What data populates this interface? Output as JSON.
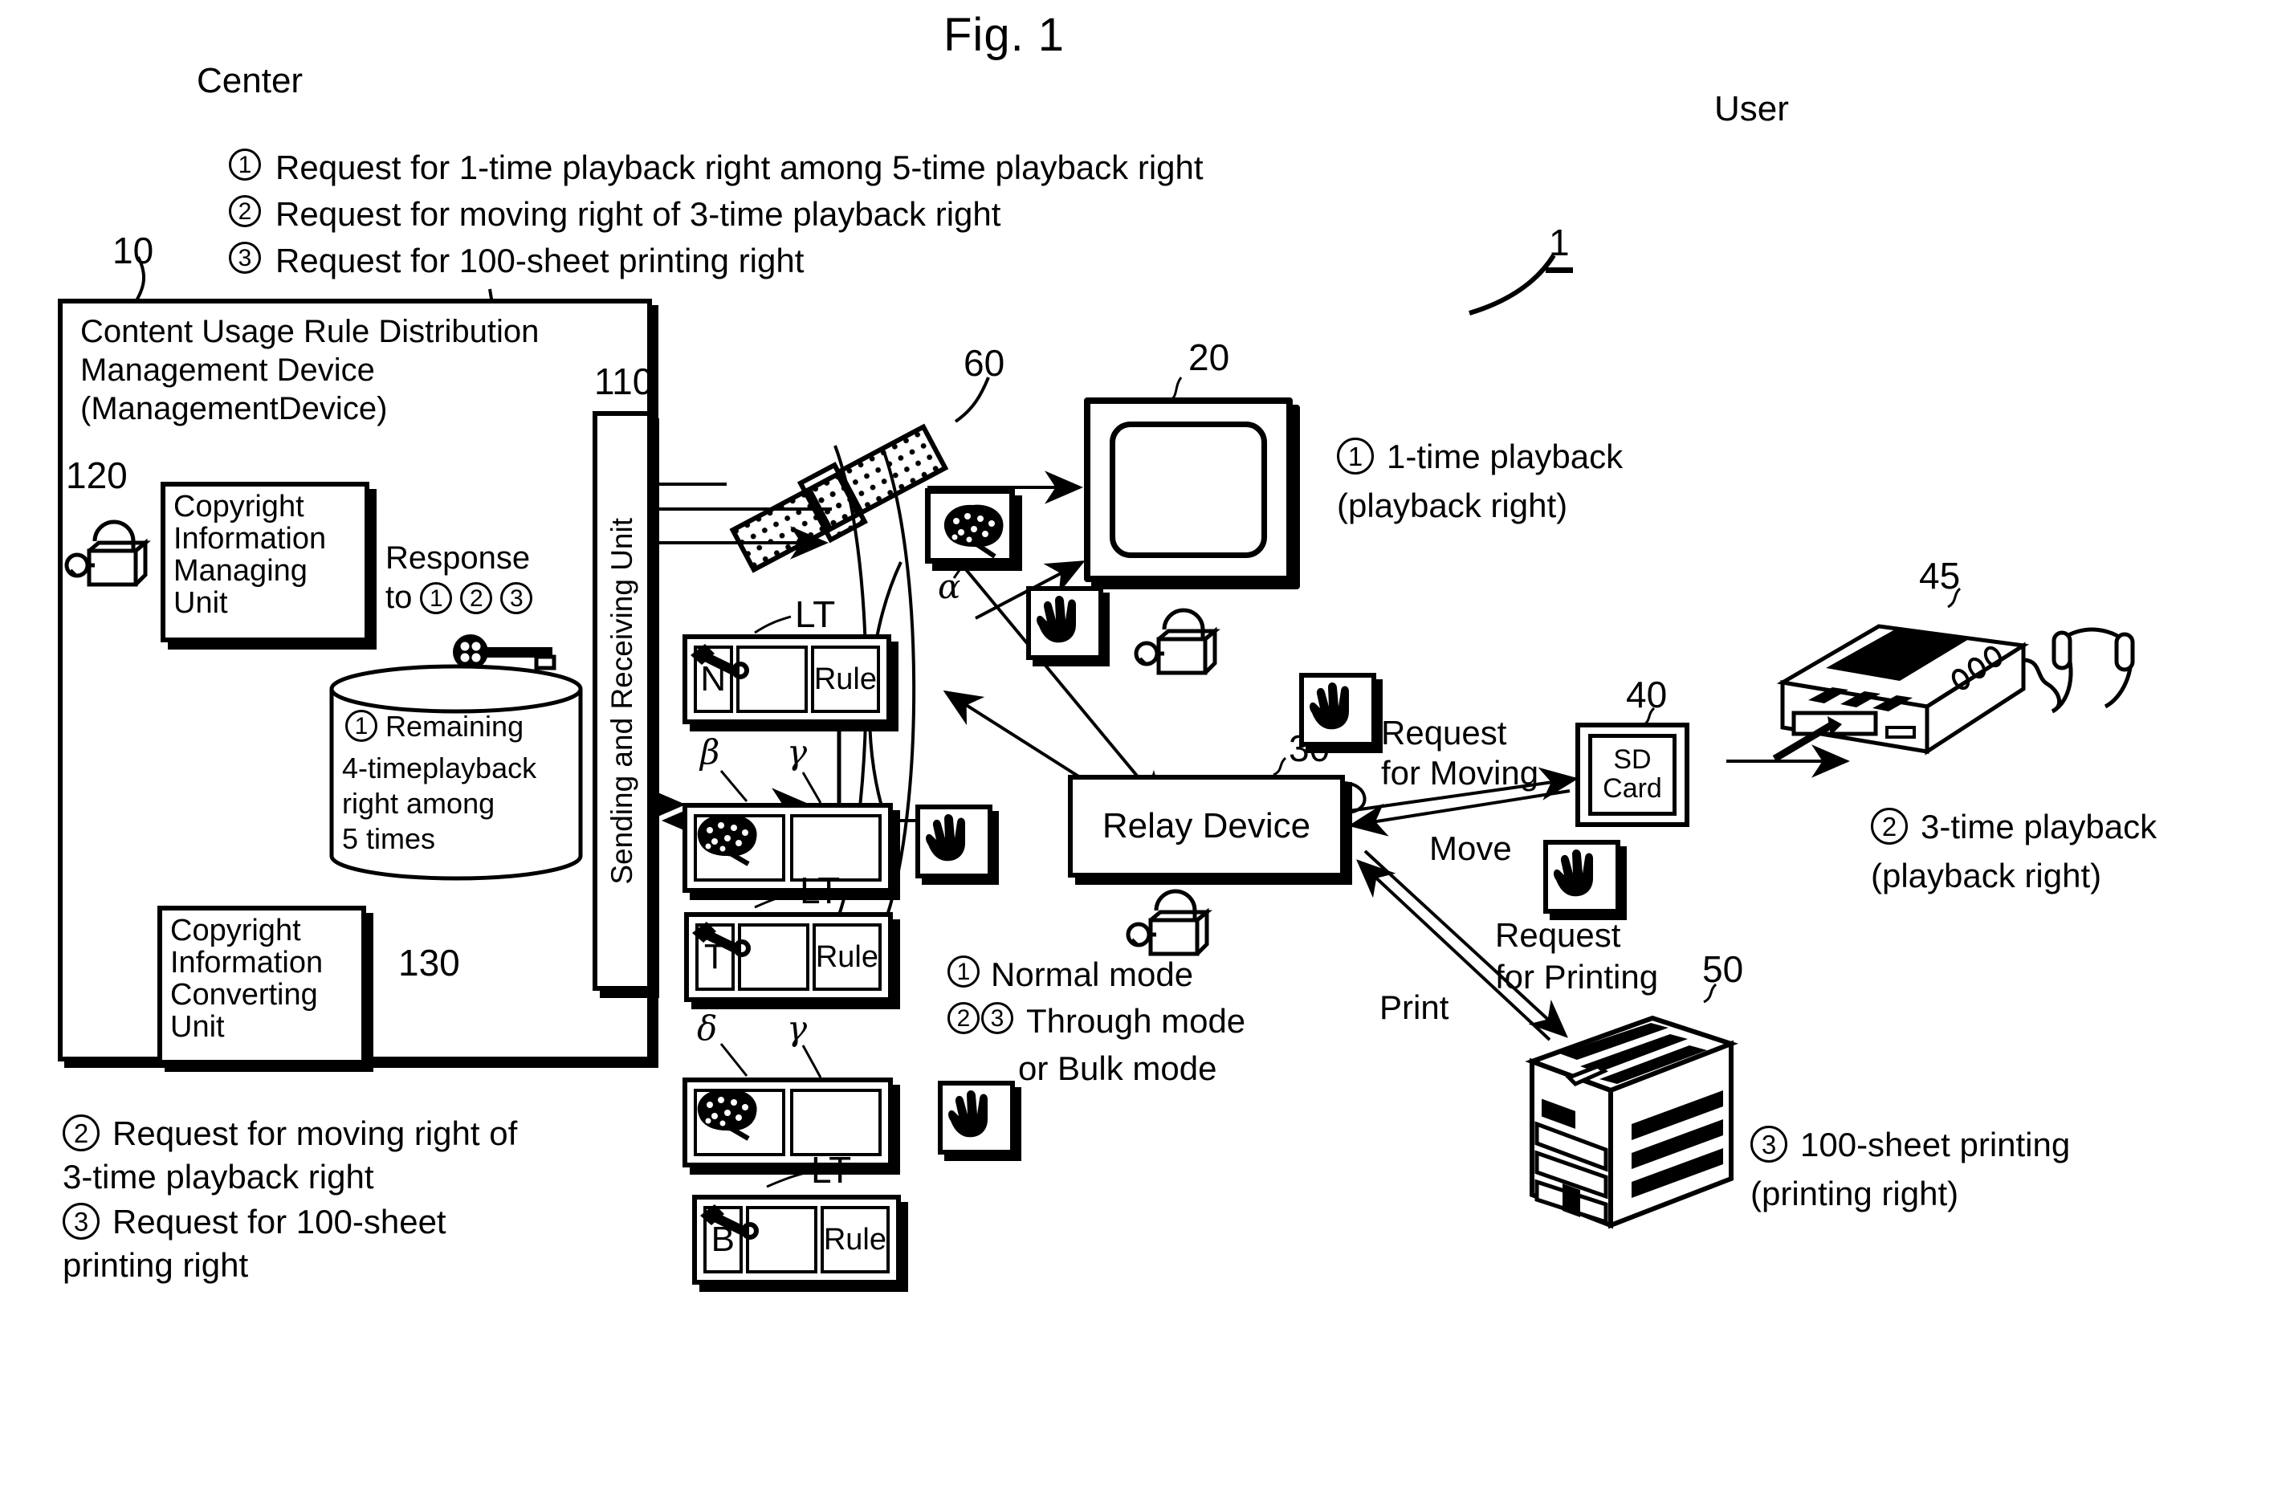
{
  "figure": {
    "title": "Fig. 1",
    "system_ref": "1"
  },
  "side_labels": {
    "center": "Center",
    "user": "User"
  },
  "top_legend": [
    {
      "num": "1",
      "text": "Request for 1-time playback right among 5-time playback right"
    },
    {
      "num": "2",
      "text": "Request for moving right of 3-time playback right"
    },
    {
      "num": "3",
      "text": "Request for 100-sheet printing right"
    }
  ],
  "bottom_legend": [
    {
      "num": "2",
      "text": "Request for moving right of",
      "text2": "3-time playback right"
    },
    {
      "num": "3",
      "text": "Request for 100-sheet",
      "text2": "printing right"
    }
  ],
  "management_device": {
    "ref": "10",
    "title_line1": "Content Usage Rule Distribution",
    "title_line2": "Management Device",
    "title_line3": "(ManagementDevice)",
    "managing_unit": {
      "ref": "120",
      "label": "Copyright\nInformation\nManaging\nUnit"
    },
    "converting_unit": {
      "ref": "130",
      "label": "Copyright\nInformation\nConverting\nUnit"
    },
    "sending_receiving_unit": {
      "ref": "110",
      "label": "Sending and Receiving Unit"
    },
    "response_label_line1": "Response",
    "response_label_line2": "to",
    "response_nums": [
      "1",
      "2",
      "3"
    ],
    "database": {
      "num": "1",
      "line1": "Remaining",
      "line2": "4-timeplayback",
      "line3": "right among",
      "line4": "5 times"
    }
  },
  "satellite": {
    "ref": "60"
  },
  "tv": {
    "ref": "20",
    "caption_num": "1",
    "caption_line1": "1-time playback",
    "caption_line2": "(playback right)"
  },
  "relay_device": {
    "ref": "30",
    "label": "Relay Device",
    "modes": [
      {
        "nums": "1",
        "text": "Normal mode"
      },
      {
        "nums": "23",
        "text": "Through mode",
        "text2": "or Bulk mode"
      }
    ]
  },
  "sd_card": {
    "ref": "40",
    "line1": "SD",
    "line2": "Card"
  },
  "portable_player": {
    "ref": "45",
    "caption_num": "2",
    "caption_line1": "3-time playback",
    "caption_line2": "(playback right)"
  },
  "printer": {
    "ref": "50",
    "caption_num": "3",
    "caption_line1": "100-sheet printing",
    "caption_line2": "(printing right)"
  },
  "flow_labels": {
    "request_for_moving_l1": "Request",
    "request_for_moving_l2": "for Moving",
    "move": "Move",
    "request_for_printing_l1": "Request",
    "request_for_printing_l2": "for Printing",
    "print": "Print"
  },
  "lt_blocks": [
    {
      "tag": "LT",
      "code": "N",
      "rule": "Rule",
      "icon": "key-icon"
    },
    {
      "tag": "LT",
      "code": "T",
      "rule": "Rule",
      "icon": "key-icon"
    },
    {
      "tag": "LT",
      "code": "B",
      "rule": "Rule",
      "icon": "key-icon"
    }
  ],
  "content_blocks": [
    {
      "labels": [
        "β",
        "γ"
      ]
    },
    {
      "labels": [
        "δ",
        "γ"
      ]
    }
  ],
  "alpha_label": "α"
}
